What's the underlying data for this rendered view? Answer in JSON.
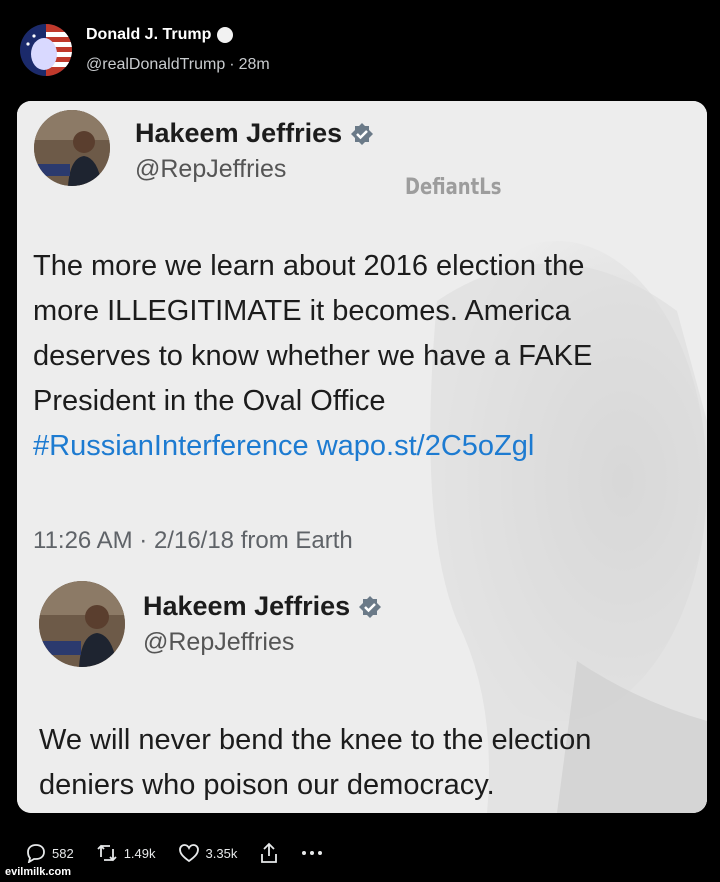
{
  "post": {
    "author_name": "Donald J. Trump",
    "handle": "@realDonaldTrump",
    "separator": "·",
    "time_ago": "28m"
  },
  "quoted_tweet_1": {
    "author_name": "Hakeem Jeffries",
    "handle": "@RepJeffries",
    "text_lines": [
      "The more we learn about 2016 election the",
      "more ILLEGITIMATE it becomes. America",
      "deserves to know whether we have a FAKE",
      "President in the Oval Office"
    ],
    "hashtag": "#RussianInterference",
    "link": "wapo.st/2C5oZgl",
    "timestamp": "11:26 AM · 2/16/18 from Earth"
  },
  "quoted_tweet_2": {
    "author_name": "Hakeem Jeffries",
    "handle": "@RepJeffries",
    "text_lines": [
      "We will never bend the knee to the election",
      "deniers who poison our democracy."
    ]
  },
  "watermark": "DefiantLs",
  "actions": {
    "replies": "582",
    "reposts": "1.49k",
    "likes": "3.35k"
  },
  "site_credit": "evilmilk.com",
  "colors": {
    "link_blue": "#1d7bd1",
    "verified_gray": "#6b7a88",
    "card_bg": "#ededed"
  },
  "icons": [
    "verified-badge-icon",
    "reply-icon",
    "repost-icon",
    "like-icon",
    "share-icon",
    "more-icon"
  ]
}
